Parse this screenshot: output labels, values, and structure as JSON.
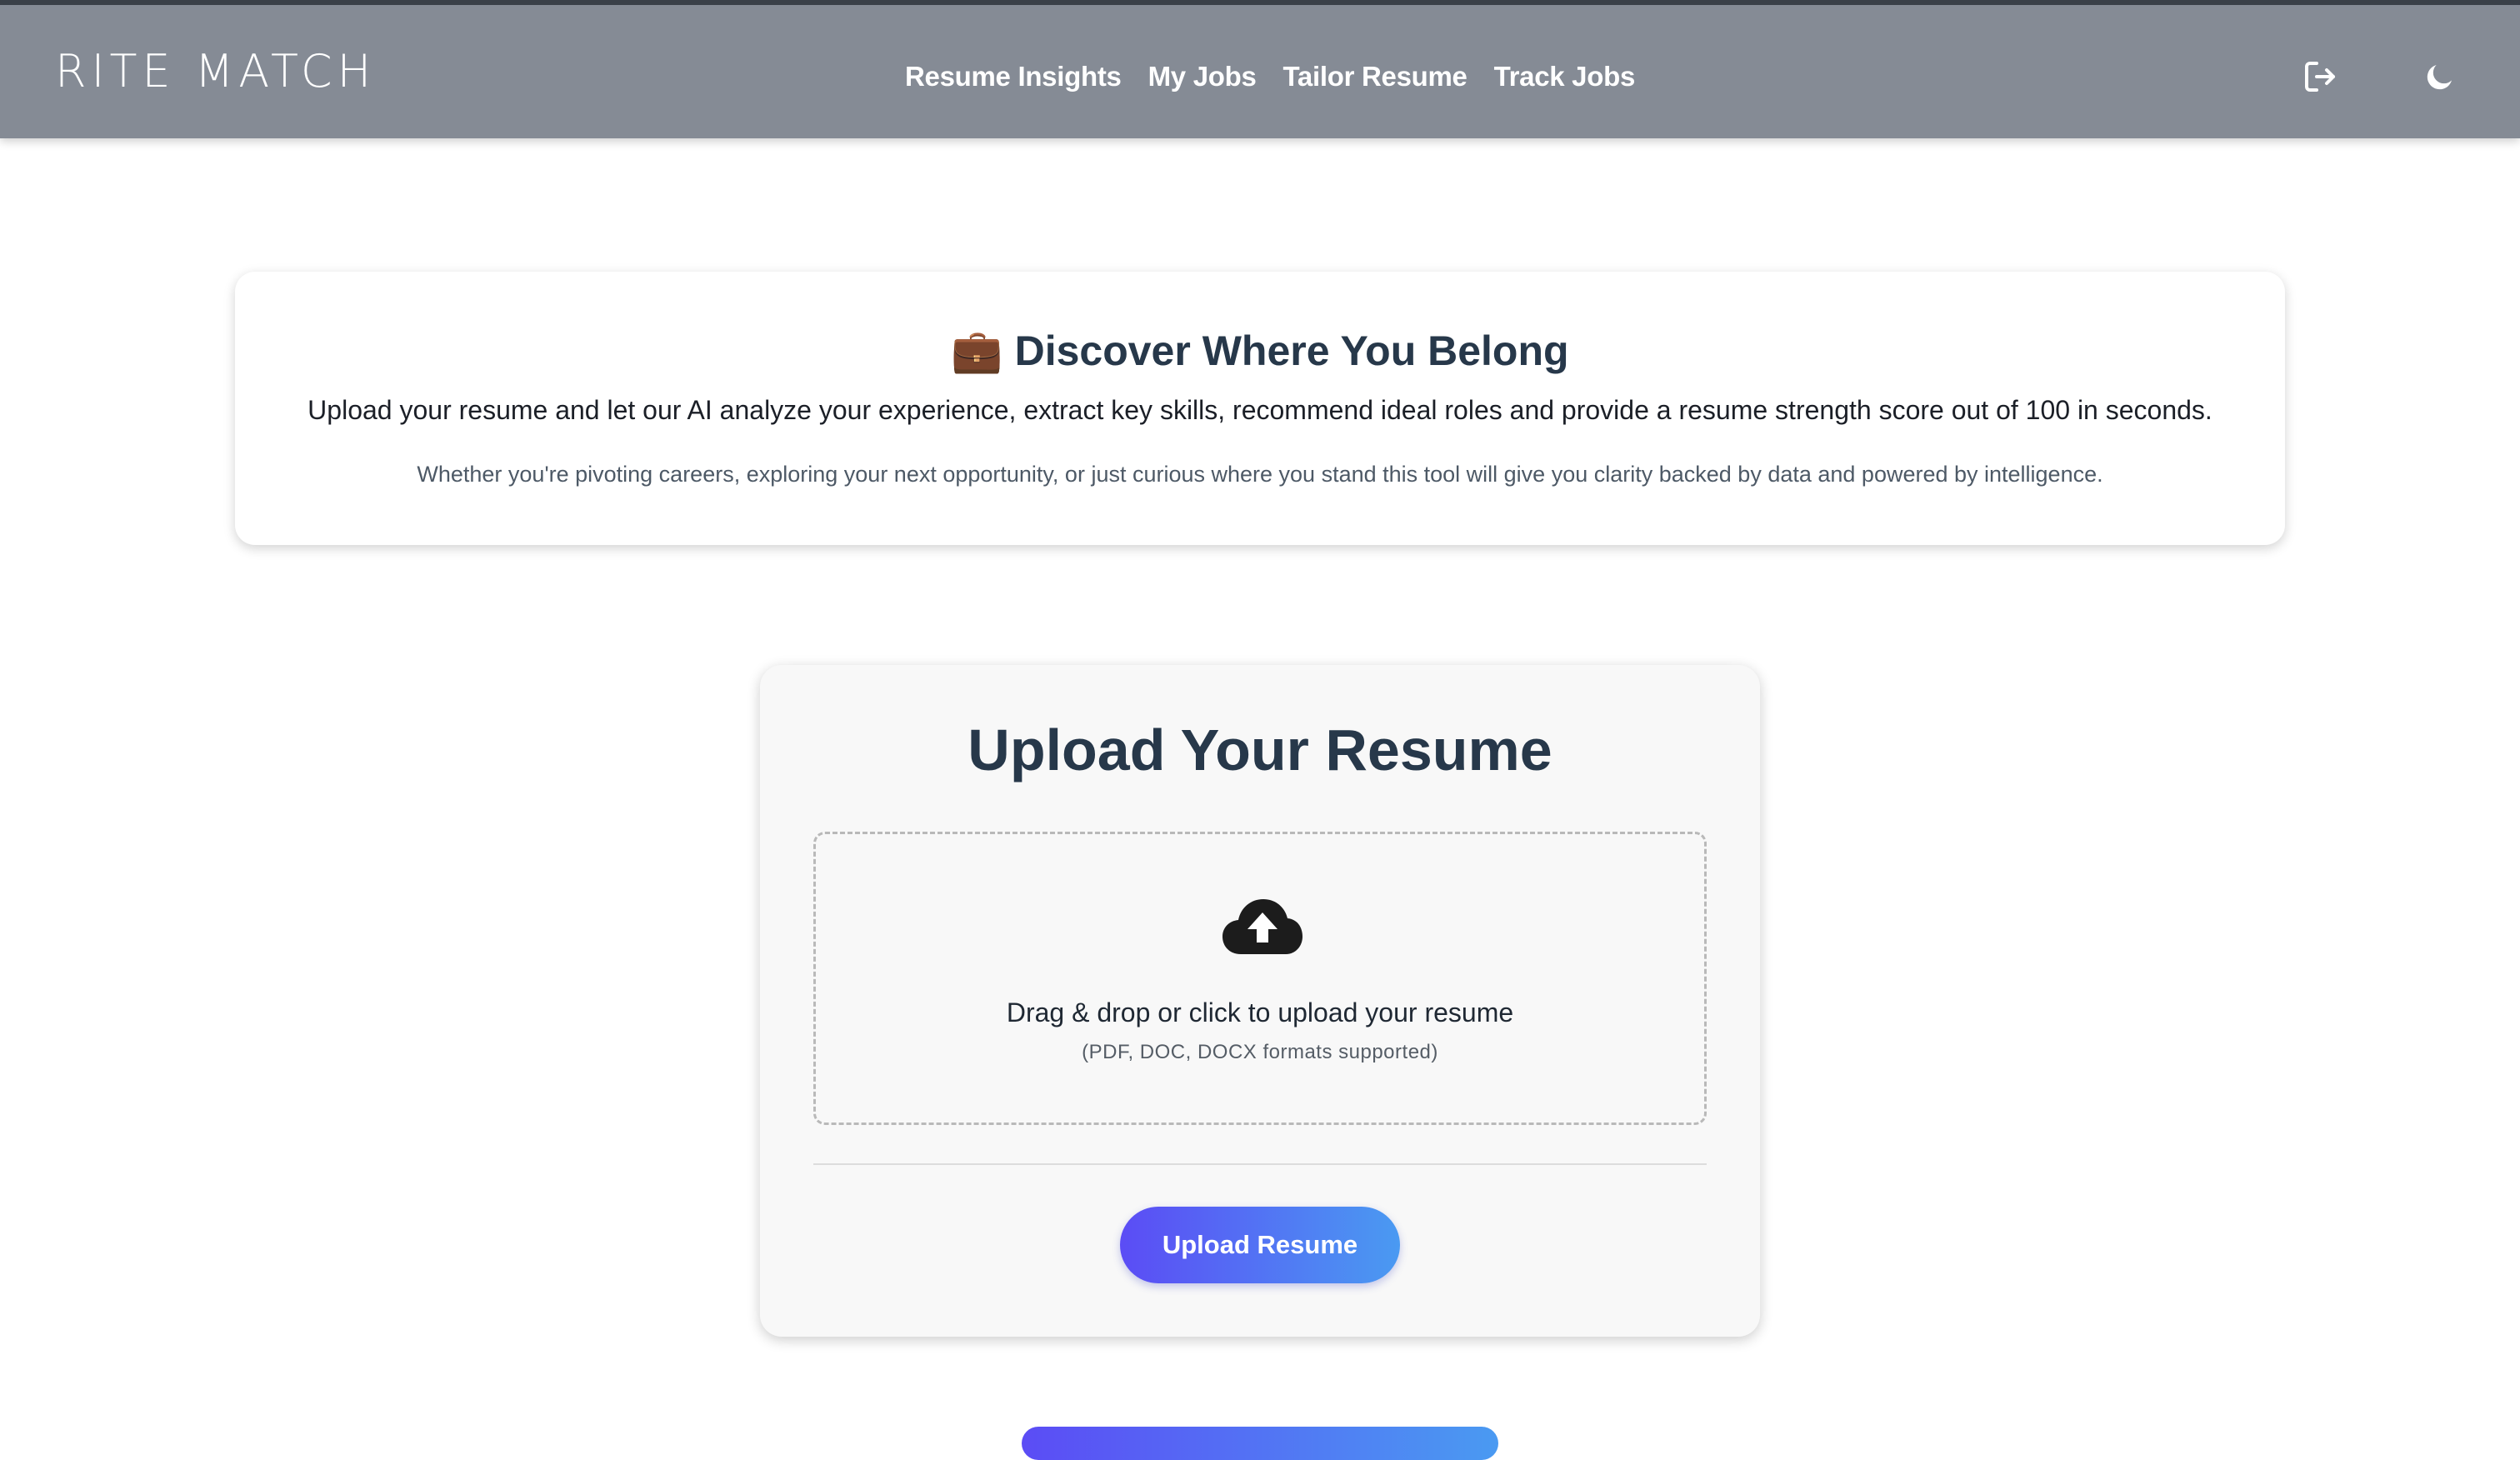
{
  "header": {
    "logo_text": "RITE MATCH",
    "nav": [
      {
        "label": "Resume Insights"
      },
      {
        "label": "My Jobs"
      },
      {
        "label": "Tailor Resume"
      },
      {
        "label": "Track Jobs"
      }
    ],
    "icons": {
      "logout": "logout-icon",
      "theme": "moon-icon"
    }
  },
  "intro": {
    "emoji": "💼",
    "title": "Discover Where You Belong",
    "text": "Upload your resume and let our AI analyze your experience, extract key skills, recommend ideal roles and provide a resume strength score out of 100 in seconds.",
    "subtext": "Whether you're pivoting careers, exploring your next opportunity, or just curious where you stand this tool will give you clarity backed by data and powered by intelligence."
  },
  "upload": {
    "title": "Upload Your Resume",
    "drop_text": "Drag & drop or click to upload your resume",
    "drop_sub": "(PDF, DOC, DOCX formats supported)",
    "button_label": "Upload Resume",
    "icon": "cloud-upload-icon"
  },
  "colors": {
    "header_bg": "#858b95",
    "button_gradient_start": "#5b4cf5",
    "button_gradient_end": "#4a9af2",
    "title_color": "#27384a"
  }
}
